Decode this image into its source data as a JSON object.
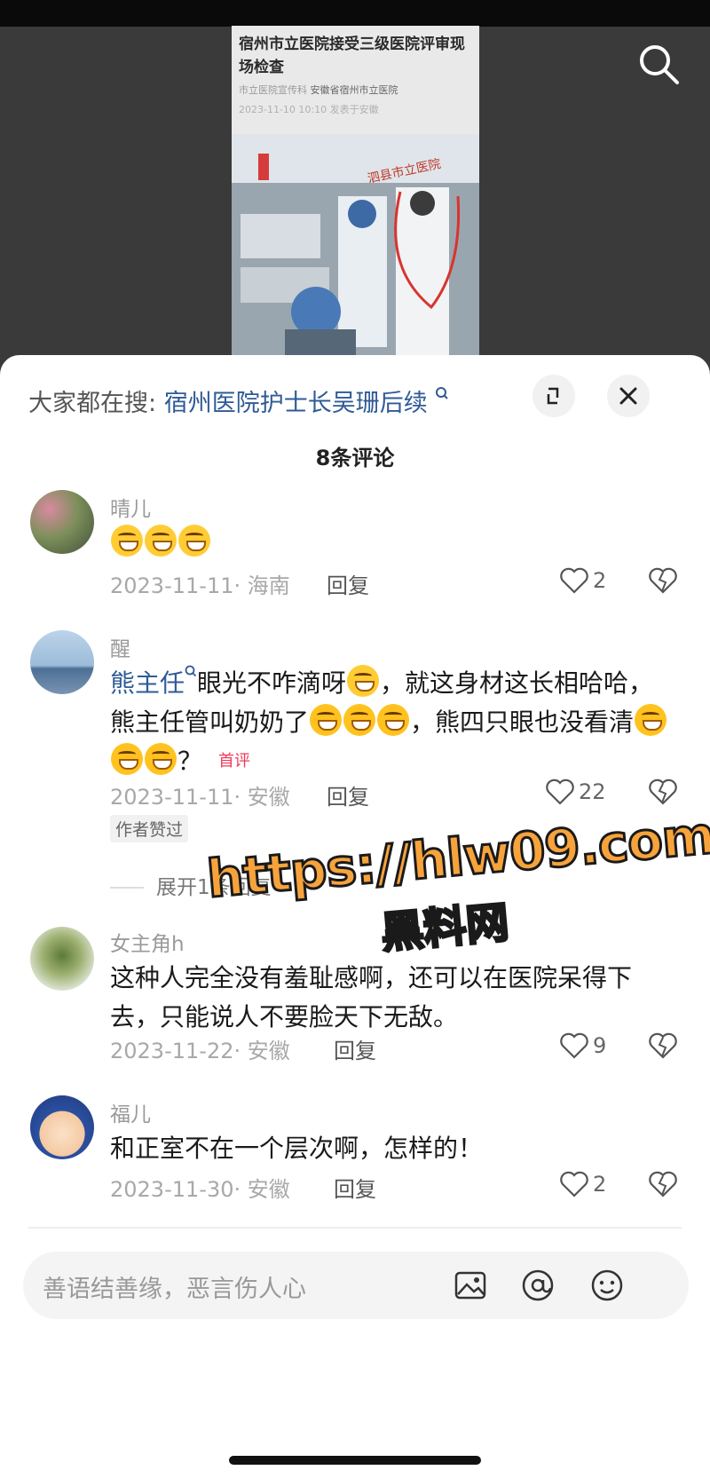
{
  "video": {
    "title": "宿州市立医院接受三级医院评审现场检查",
    "source": "市立医院宣传科",
    "department": "安徽省宿州市立医院",
    "date": "2023-11-10 10:10  发表于安徽",
    "photo_sign": "泗县市立医院"
  },
  "header": {
    "hot_search_prefix": "大家都在搜:",
    "hot_search_link": "宿州医院护士长吴珊后续",
    "comment_count": "8条评论"
  },
  "comments": [
    {
      "user": "晴儿",
      "text": "",
      "emoji_count": 3,
      "meta": "2023-11-11· 海南",
      "reply": "回复",
      "likes": "2"
    },
    {
      "user": "醒",
      "mention": "熊主任",
      "text_a": "眼光不咋滴呀",
      "text_b": "，就这身材这长相哈哈，熊主任管叫奶奶了",
      "text_c": "，熊四只眼也没看清",
      "text_d": "？",
      "badge": "首评",
      "meta": "2023-11-11· 安徽",
      "reply": "回复",
      "likes": "22",
      "author_badge": "作者赞过",
      "expand": "展开1条回复"
    },
    {
      "user": "女主角h",
      "text": "这种人完全没有羞耻感啊，还可以在医院呆得下去，只能说人不要脸天下无敌。",
      "meta": "2023-11-22· 安徽",
      "reply": "回复",
      "likes": "9"
    },
    {
      "user": "福儿",
      "text": "和正室不在一个层次啊，怎样的！",
      "meta": "2023-11-30· 安徽",
      "reply": "回复",
      "likes": "2"
    }
  ],
  "watermark": {
    "line1": "https://hlw09.com",
    "line2": "黑料网"
  },
  "input": {
    "placeholder": "善语结善缘，恶言伤人心"
  },
  "icons": [
    "search-icon",
    "fullscreen-icon",
    "close-icon",
    "heart-icon",
    "dislike-icon",
    "image-icon",
    "at-icon",
    "emoji-icon"
  ]
}
